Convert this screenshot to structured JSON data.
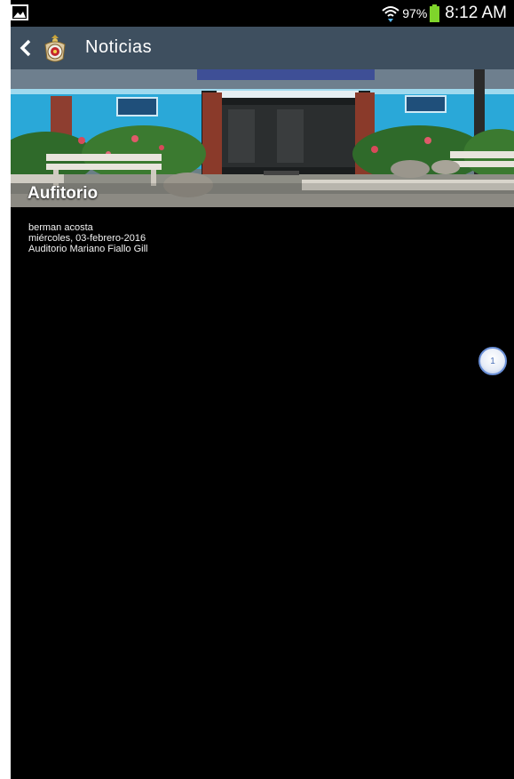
{
  "status_bar": {
    "battery_percent": "97%",
    "time": "8:12 AM",
    "icons": [
      "gallery-icon",
      "wifi-icon",
      "battery-icon"
    ]
  },
  "action_bar": {
    "title": "Noticias",
    "icons": [
      "back-arrow-icon",
      "app-logo-icon"
    ]
  },
  "article": {
    "title": "Aufitorio",
    "author": "berman acosta",
    "date": "miércoles, 03-febrero-2016",
    "location": "Auditorio Mariano Fiallo Gill"
  },
  "pager": {
    "page": "1"
  },
  "colors": {
    "action_bar": "#3e4f5f",
    "background": "#000000",
    "battery": "#7fd42b",
    "wall": "#2aa8d8"
  }
}
